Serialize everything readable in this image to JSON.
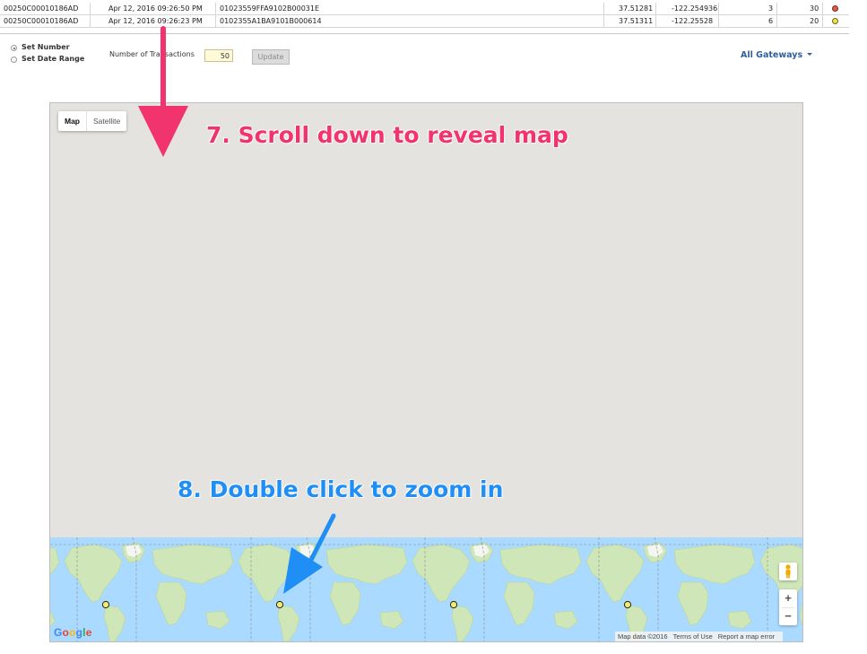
{
  "table": {
    "rows": [
      {
        "id": "00250C00010186AD",
        "time": "Apr 12, 2016 09:26:50 PM",
        "code": "01023559FFA9102B00031E",
        "lat": "37.51281",
        "lng": "-122.254936",
        "n1": "3",
        "n2": "30",
        "status_color": "#e05a4a"
      },
      {
        "id": "00250C00010186AD",
        "time": "Apr 12, 2016 09:26:23 PM",
        "code": "0102355A1BA9101B000614",
        "lat": "37.51311",
        "lng": "-122.25528",
        "n1": "6",
        "n2": "20",
        "status_color": "#f2e24a"
      }
    ]
  },
  "controls": {
    "set_number": "Set Number",
    "set_date_range": "Set Date Range",
    "num_transactions_label": "Number of Transactions",
    "num_transactions_value": "50",
    "update_label": "Update",
    "gateways_label": "All Gateways"
  },
  "map": {
    "type_map": "Map",
    "type_satellite": "Satellite",
    "zoom_in": "+",
    "zoom_out": "−",
    "logo": "Google",
    "attribution": {
      "data": "Map data ©2016",
      "terms": "Terms of Use",
      "report": "Report a map error"
    },
    "marker_color": "#f4ec68",
    "water_color": "#aadaff",
    "land_color": "#cfe6b8"
  },
  "annotations": {
    "step7": "7. Scroll down to reveal map",
    "step8": "8. Double click to zoom in",
    "step7_color": "#f2346e",
    "step8_color": "#1f8ef5"
  }
}
